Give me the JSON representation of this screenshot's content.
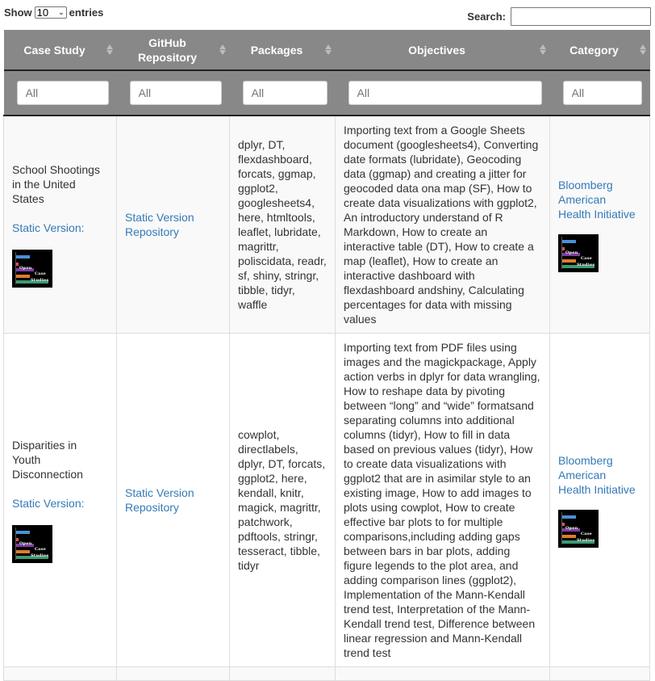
{
  "length_menu": {
    "prefix": "Show",
    "selected": "10",
    "suffix": "entries"
  },
  "search": {
    "label": "Search:",
    "value": ""
  },
  "table": {
    "columns": [
      {
        "label": "Case Study"
      },
      {
        "label": "GitHub Repository"
      },
      {
        "label": "Packages"
      },
      {
        "label": "Objectives"
      },
      {
        "label": "Category"
      }
    ],
    "filters": [
      {
        "placeholder": "All"
      },
      {
        "placeholder": "All"
      },
      {
        "placeholder": "All"
      },
      {
        "placeholder": "All"
      },
      {
        "placeholder": "All"
      }
    ],
    "rows": [
      {
        "case_study": "School Shootings in the United States",
        "static_version": "Static Version:",
        "logo_text": [
          "Open",
          "Case",
          "Studies"
        ],
        "repository": "Static Version Repository",
        "packages": "dplyr, DT, flexdashboard, forcats, ggmap, ggplot2, googlesheets4, here, htmltools, leaflet, lubridate, magrittr, poliscidata, readr, sf, shiny, stringr, tibble, tidyr, waffle",
        "objectives": "Importing text from a Google Sheets document (googlesheets4), Converting date formats (lubridate), Geocoding data (ggmap) and creating a jitter for geocoded data ona map (SF), How to create data visualizations with ggplot2, An introductory understand of R Markdown, How to create an interactive table (DT), How to create a map (leaflet), How to create an interactive dashboard with flexdashboard andshiny, Calculating percentages for data with missing values",
        "category": "Bloomberg American Health Initiative"
      },
      {
        "case_study": "Disparities in Youth Disconnection",
        "static_version": "Static Version:",
        "logo_text": [
          "Open",
          "Case",
          "Studies"
        ],
        "repository": "Static Version Repository",
        "packages": "cowplot, directlabels, dplyr, DT, forcats, ggplot2, here, kendall, knitr, magick, magrittr, patchwork, pdftools, stringr, tesseract, tibble, tidyr",
        "objectives": "Importing text from PDF files using images and the magickpackage, Apply action verbs in dplyr for data wrangling, How to reshape data by pivoting between “long” and “wide” formatsand separating columns into additional columns (tidyr), How to fill in data based on previous values (tidyr), How to create data visualizations with ggplot2 that are in asimilar style to an existing image, How to add images to plots using cowplot, How to create effective bar plots to for multiple comparisons,including adding gaps between bars in bar plots, adding figure legends to the plot area, and adding comparison lines (ggplot2), Implementation of the Mann-Kendall trend test, Interpretation of the Mann-Kendall trend test, Difference between linear regression and Mann-Kendall trend test",
        "category": "Bloomberg American Health Initiative"
      }
    ]
  },
  "colors": {
    "header_bg": "#888888",
    "link": "#337ab7",
    "odd_row_bg": "#f9f9f9"
  }
}
